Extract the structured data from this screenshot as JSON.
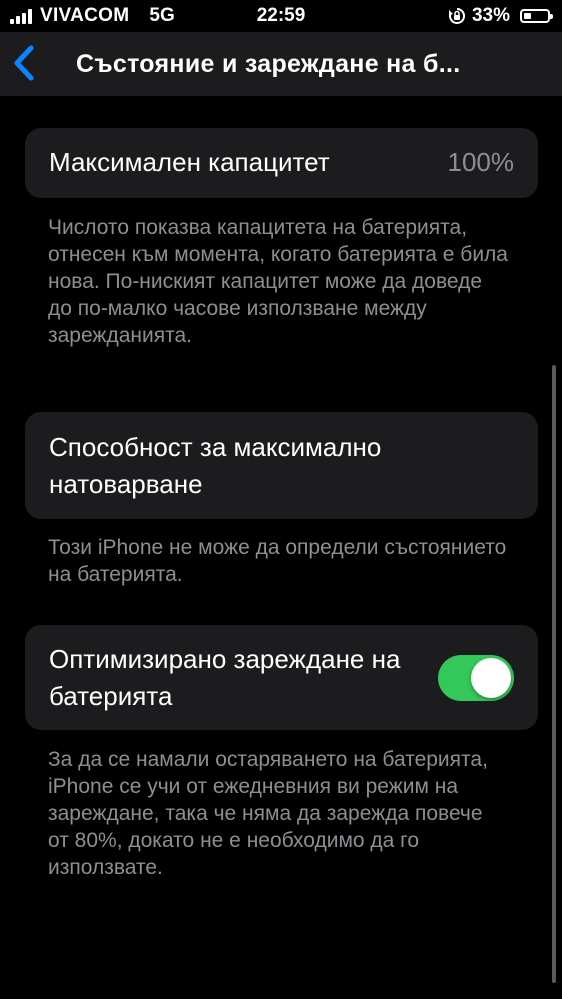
{
  "status_bar": {
    "carrier": "VIVACOM",
    "network": "5G",
    "time": "22:59",
    "battery_percent": "33%",
    "battery_level": 0.33
  },
  "nav": {
    "title": "Състояние и зареждане на б..."
  },
  "max_capacity": {
    "label": "Максимален капацитет",
    "value": "100%",
    "description": "Числото показва капацитета на батерията, отнесен към момента, когато батерията е била нова. По-ниският капацитет може да доведе до по-малко часове използване между зарежданията."
  },
  "peak_performance": {
    "label": "Способност за максимално натоварване",
    "description": "Този iPhone не може да определи състоянието на батерията."
  },
  "optimized_charging": {
    "label": "Оптимизирано зареждане на батерията",
    "enabled": true,
    "description": "За да се намали остаряването на батерията, iPhone се учи от ежедневния ви режим на зареждане, така че няма да зарежда повече от 80%, докато не е необходимо да го използвате."
  },
  "colors": {
    "background": "#000000",
    "card": "#1c1c1e",
    "accent": "#0a84ff",
    "toggle_on": "#34c759",
    "secondary_text": "#8e8e93"
  }
}
